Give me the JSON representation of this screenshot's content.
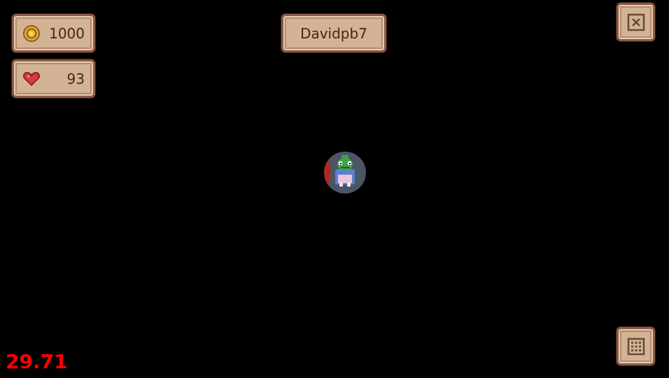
{
  "hud": {
    "coins": {
      "icon": "coin-icon",
      "value": "1000"
    },
    "health": {
      "icon": "heart-icon",
      "value": "93"
    },
    "player_name": "Davidpb7",
    "close_button": {
      "icon": "close-icon"
    },
    "menu_button": {
      "icon": "grid-icon"
    },
    "fps": "29.71"
  },
  "player": {
    "sprite": "frog-hero-sprite"
  },
  "colors": {
    "background": "#000000",
    "panel_fill": "#d2b396",
    "panel_border": "#8a5a44",
    "text": "#4a2418",
    "fps": "#ff0000"
  }
}
